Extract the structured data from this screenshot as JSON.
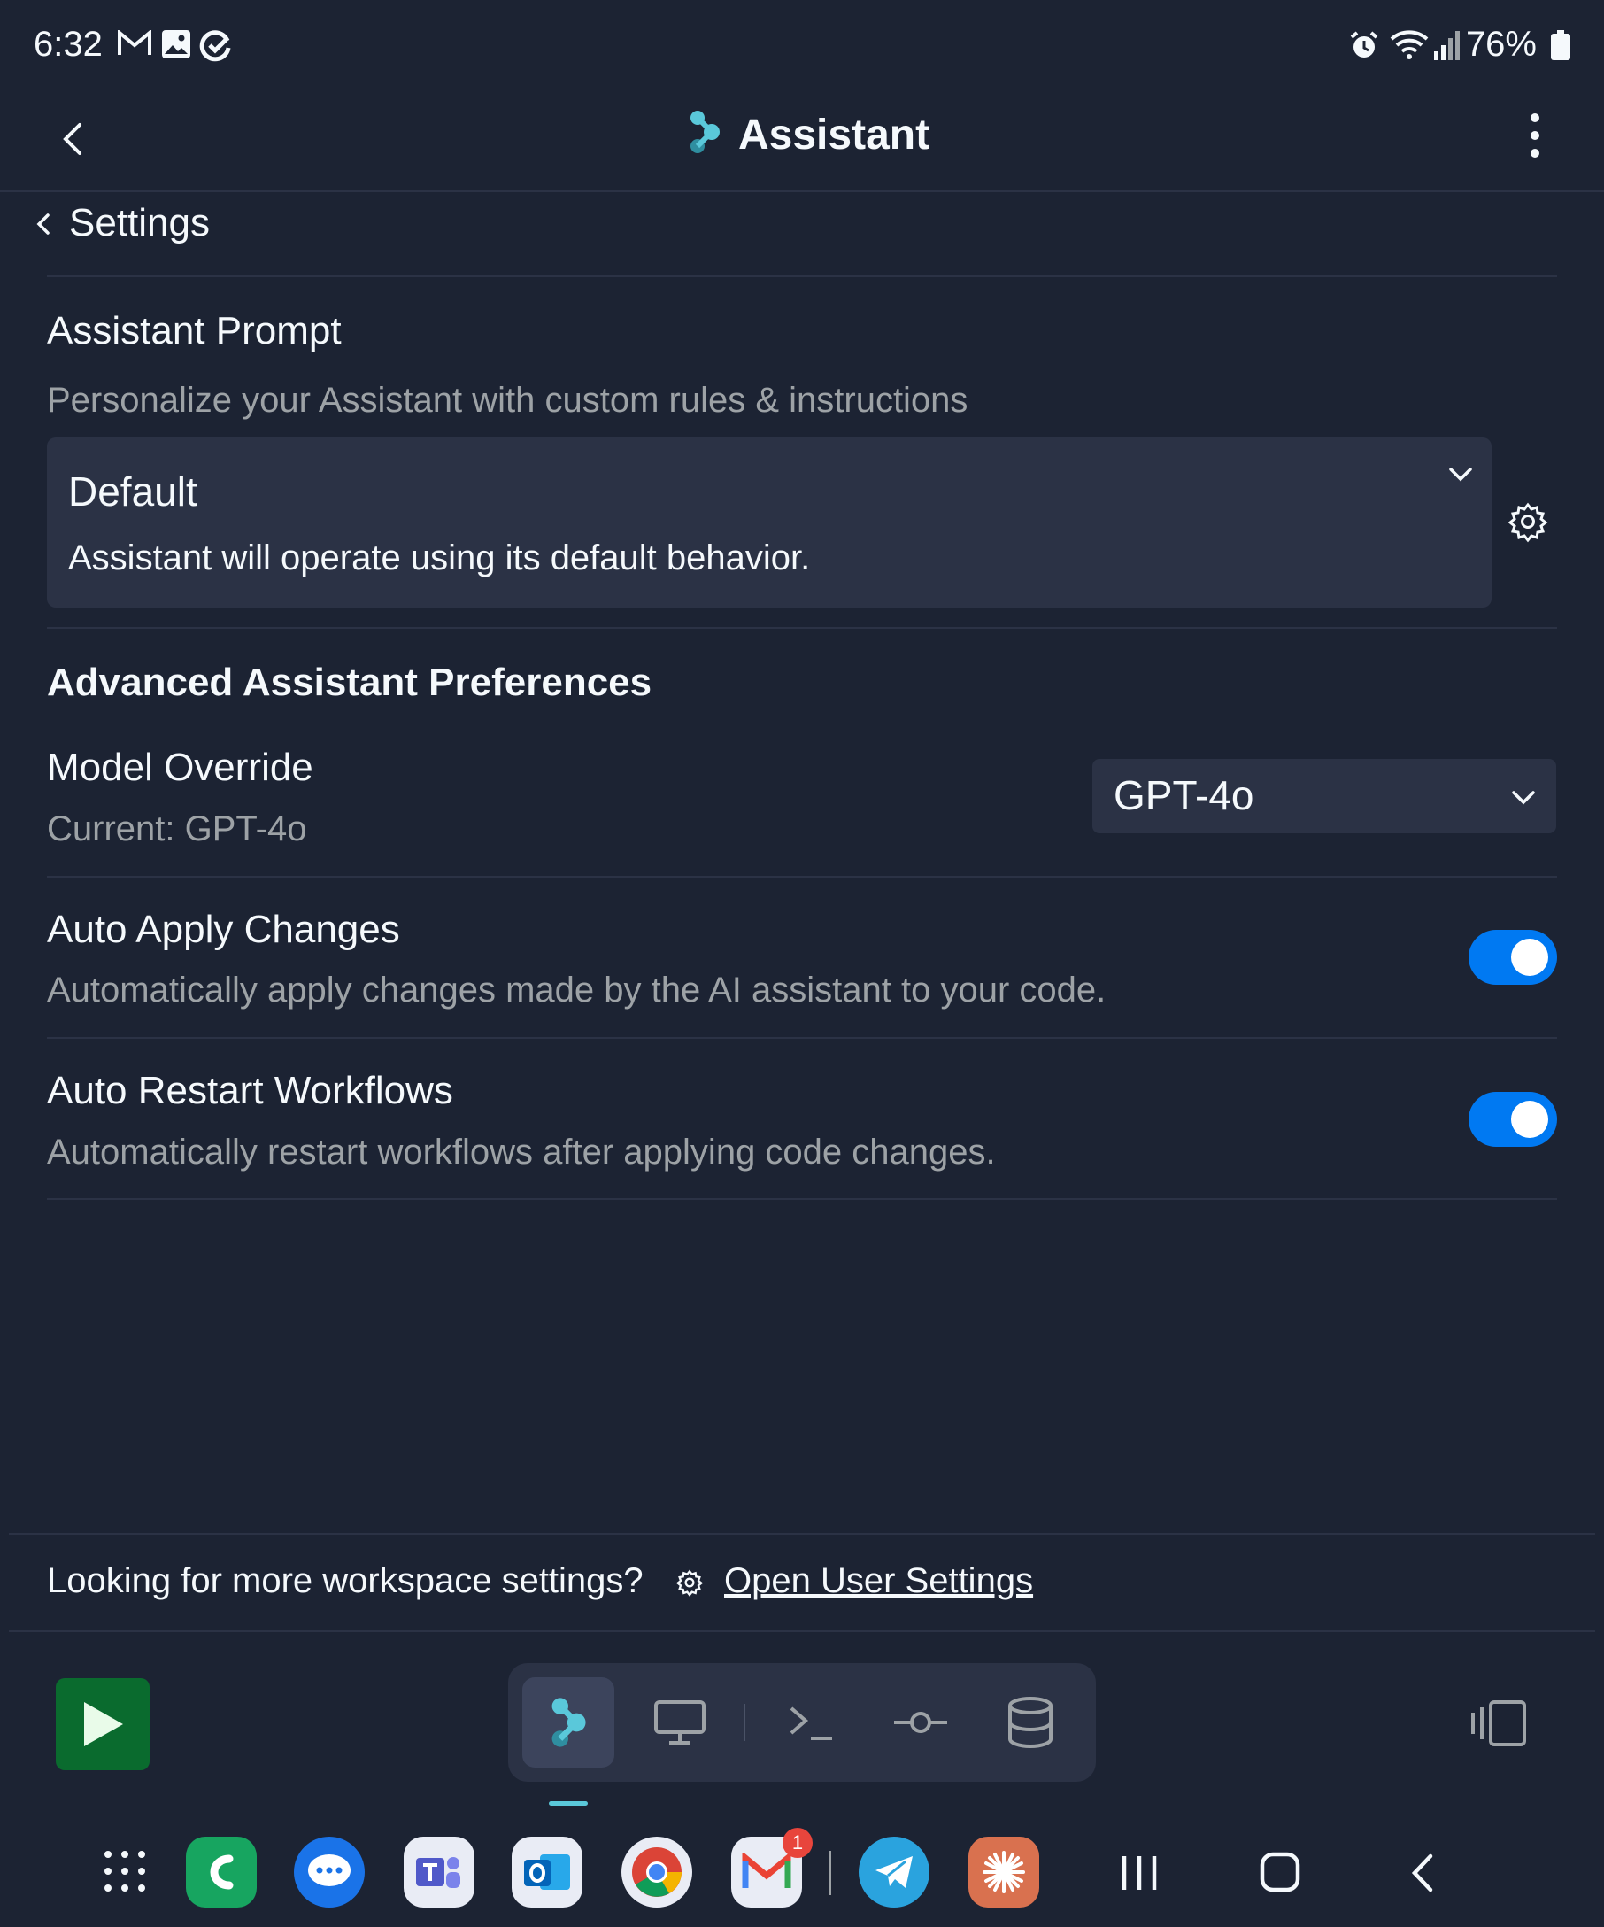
{
  "status_bar": {
    "time": "6:32",
    "battery": "76%"
  },
  "header": {
    "title": "Assistant"
  },
  "breadcrumb": {
    "label": "Settings"
  },
  "prompt_section": {
    "title": "Assistant Prompt",
    "subtitle": "Personalize your Assistant with custom rules & instructions",
    "selected_name": "Default",
    "selected_description": "Assistant will operate using its default behavior."
  },
  "advanced": {
    "title": "Advanced Assistant Preferences",
    "model": {
      "label": "Model Override",
      "current": "Current: GPT-4o",
      "selected": "GPT-4o"
    },
    "auto_apply": {
      "label": "Auto Apply Changes",
      "description": "Automatically apply changes made by the AI assistant to your code.",
      "enabled": true
    },
    "auto_restart": {
      "label": "Auto Restart Workflows",
      "description": "Automatically restart workflows after applying code changes.",
      "enabled": true
    }
  },
  "footer": {
    "question": "Looking for more workspace settings?",
    "link": "Open User Settings"
  },
  "toolbar": {
    "tools": [
      "assistant-icon",
      "monitor-icon",
      "terminal-icon",
      "git-commit-icon",
      "database-icon"
    ]
  },
  "dock": {
    "gmail_badge": "1"
  },
  "colors": {
    "background": "#1c2333",
    "surface": "#2b3245",
    "accent": "#0079f2",
    "run": "#0a6b2e"
  }
}
